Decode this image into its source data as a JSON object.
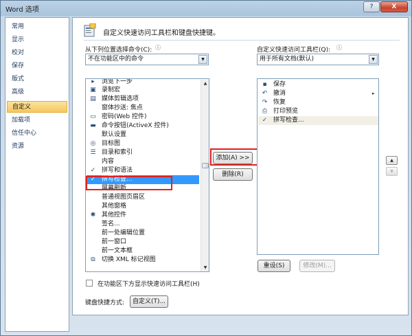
{
  "window": {
    "title": "Word 选项",
    "help_label": "?",
    "close_label": "X"
  },
  "nav": {
    "items": [
      {
        "label": "常用"
      },
      {
        "label": "显示"
      },
      {
        "label": "校对"
      },
      {
        "label": "保存"
      },
      {
        "label": "版式"
      },
      {
        "label": "高级"
      },
      {
        "label": "自定义",
        "selected": true
      },
      {
        "label": "加载项"
      },
      {
        "label": "信任中心"
      },
      {
        "label": "资源"
      }
    ]
  },
  "main": {
    "header": "自定义快速访问工具栏和键盘快捷键。",
    "choose_from_label": "从下列位置选择命令(C):",
    "choose_from_value": "不在功能区中的命令",
    "customize_label": "自定义快速访问工具栏(Q):",
    "customize_value": "用于所有文档(默认)",
    "info_icon": "info-icon",
    "commands": [
      {
        "label": "浏览下一步",
        "icon": "browse-icon"
      },
      {
        "label": "录制宏",
        "icon": "record-macro-icon"
      },
      {
        "label": "媒体剪辑选项",
        "icon": "media-icon"
      },
      {
        "label": "窗体抄送: 焦点",
        "icon": ""
      },
      {
        "label": "密码(Web 控件)",
        "icon": "password-control-icon"
      },
      {
        "label": "命令按钮(ActiveX 控件)",
        "icon": "activex-button-icon"
      },
      {
        "label": "默认设置",
        "icon": ""
      },
      {
        "label": "目标图",
        "icon": "target-icon"
      },
      {
        "label": "目录和索引",
        "icon": "toc-icon"
      },
      {
        "label": "内容",
        "icon": ""
      },
      {
        "label": "拼写和语法",
        "icon": "spelling-grammar-icon"
      },
      {
        "label": "拼写检查...",
        "icon": "spell-check-icon",
        "selected": true
      },
      {
        "label": "屏幕刷新",
        "icon": ""
      },
      {
        "label": "普通视图页眉区",
        "icon": ""
      },
      {
        "label": "其他窗格",
        "icon": ""
      },
      {
        "label": "其他控件",
        "icon": "other-controls-icon"
      },
      {
        "label": "签名...",
        "icon": ""
      },
      {
        "label": "前一处编辑位置",
        "icon": ""
      },
      {
        "label": "前一窗口",
        "icon": ""
      },
      {
        "label": "前一文本框",
        "icon": ""
      },
      {
        "label": "切换 XML 标记视图",
        "icon": "xml-icon"
      }
    ],
    "toolbar_items": [
      {
        "label": "保存",
        "icon": "save-icon"
      },
      {
        "label": "撤消",
        "icon": "undo-icon",
        "has_submenu": true
      },
      {
        "label": "恢复",
        "icon": "redo-icon"
      },
      {
        "label": "打印预览",
        "icon": "print-preview-icon"
      },
      {
        "label": "拼写检查...",
        "icon": "spell-check-icon",
        "highlighted": true
      }
    ],
    "add_label": "添加(A) >>",
    "remove_label": "删除(R)",
    "reset_label": "重设(S)",
    "modify_label": "修改(M)...",
    "show_below_label": "在功能区下方显示快速访问工具栏(H)",
    "shortcut_label": "键盘快捷方式:",
    "customize_button_label": "自定义(T)..."
  },
  "colors": {
    "selection": "#3399ff",
    "annotation": "#e02020",
    "nav_selected": "#f6c85d"
  }
}
